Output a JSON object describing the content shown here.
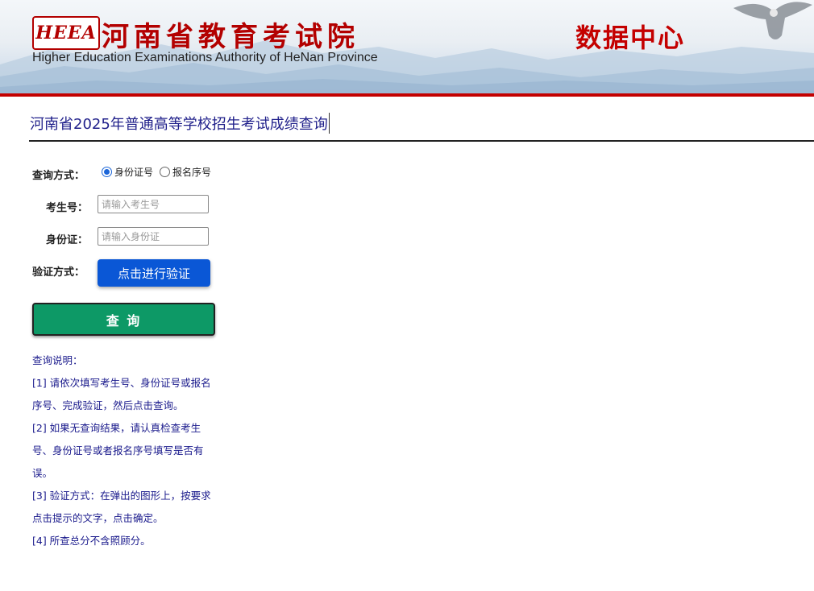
{
  "header": {
    "logo_badge": "HEEA",
    "logo_cn": "河南省教育考试院",
    "logo_en": "Higher Education Examinations Authority of HeNan Province",
    "section_title": "数据中心",
    "brand_color": "#c40000"
  },
  "page_title": "河南省2025年普通高等学校招生考试成绩查询",
  "form": {
    "method_label": "查询方式：",
    "method_options": [
      "身份证号",
      "报名序号"
    ],
    "method_selected": "身份证号",
    "exam_id_label": "考生号：",
    "exam_id_placeholder": "请输入考生号",
    "id_card_label": "身份证：",
    "id_card_placeholder": "请输入身份证",
    "verify_label": "验证方式：",
    "verify_button": "点击进行验证",
    "query_button": "查 询"
  },
  "notes": {
    "heading": "查询说明：",
    "items": [
      "[1] 请依次填写考生号、身份证号或报名序号、完成验证，然后点击查询。",
      "[2] 如果无查询结果，请认真检查考生号、身份证号或者报名序号填写是否有误。",
      "[3] 验证方式：在弹出的图形上，按要求点击提示的文字，点击确定。",
      "[4] 所查总分不含照顾分。"
    ]
  },
  "colors": {
    "verify_button": "#0a57d6",
    "query_button": "#0d9966",
    "notes_text": "#1a1a8c",
    "title_text": "#1f1f8a"
  }
}
